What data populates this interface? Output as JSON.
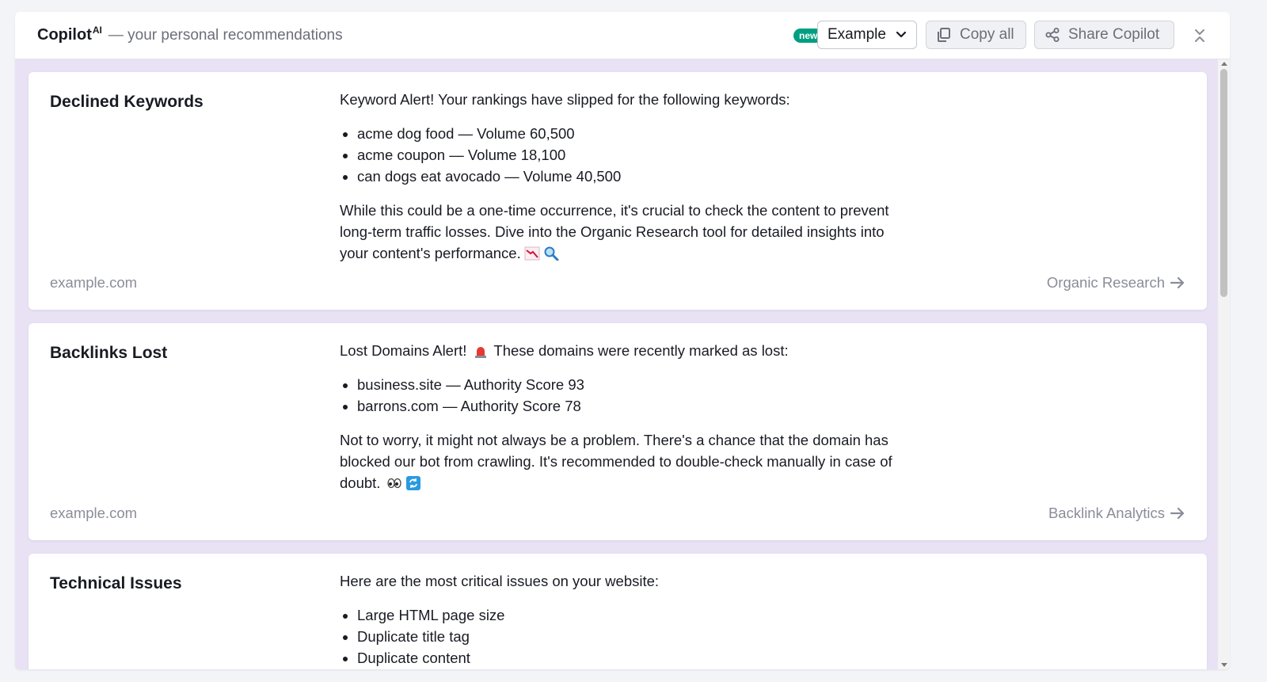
{
  "header": {
    "brand": "Copilot",
    "brand_sup": "AI",
    "subtitle": "— your personal recommendations",
    "badge": "new",
    "select_value": "Example",
    "copy_label": "Copy all",
    "share_label": "Share Copilot"
  },
  "cards": [
    {
      "title": "Declined Keywords",
      "intro": "Keyword Alert! Your rankings have slipped for the following keywords:",
      "items": [
        "acme dog food — Volume 60,500",
        "acme coupon — Volume 18,100",
        "can dogs eat avocado — Volume 40,500"
      ],
      "outro": "While this could be a one-time occurrence, it's crucial to check the content to prevent long-term traffic losses. Dive into the Organic Research tool for detailed insights into your content's performance.",
      "domain": "example.com",
      "link": "Organic Research"
    },
    {
      "title": "Backlinks Lost",
      "intro": "Lost Domains Alert!",
      "intro_tail": "These domains were recently marked as lost:",
      "items": [
        "business.site — Authority Score 93",
        "barrons.com — Authority Score 78"
      ],
      "outro": "Not to worry, it might not always be a problem. There's a chance that the domain has blocked our bot from crawling. It's recommended to double-check manually in case of doubt.",
      "domain": "example.com",
      "link": "Backlink Analytics"
    },
    {
      "title": "Technical Issues",
      "intro": "Here are the most critical issues on your website:",
      "items": [
        "Large HTML page size",
        "Duplicate title tag",
        "Duplicate content"
      ]
    }
  ]
}
